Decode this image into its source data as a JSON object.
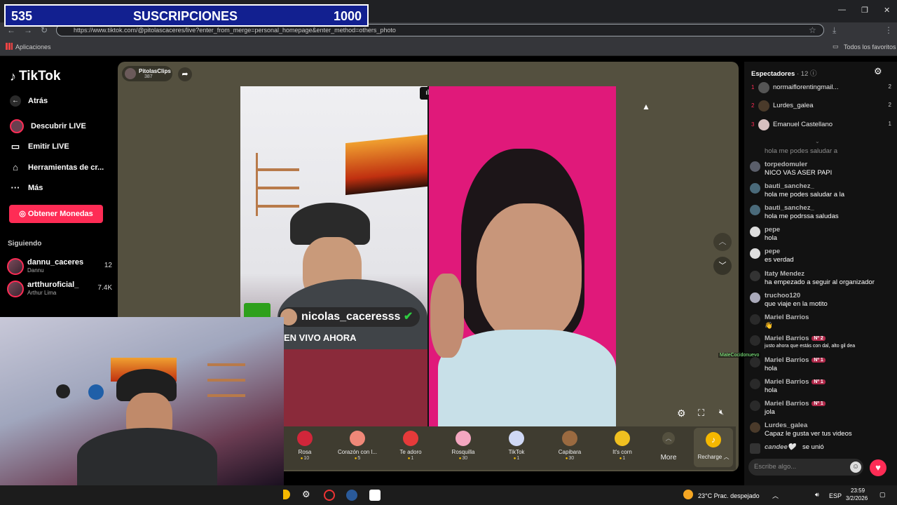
{
  "overlay": {
    "sub_current": "535",
    "sub_label": "SUSCRIPCIONES",
    "sub_goal": "1000"
  },
  "browser": {
    "url": "https://www.tiktok.com/@pitolascaceres/live?enter_from_merge=personal_homepage&enter_method=others_photo",
    "bookmark_apps": "Aplicaciones",
    "bookmark_all": "Todos los favoritos",
    "new_tab_icon": "+"
  },
  "sidebar": {
    "logo": "TikTok",
    "back": "Atrás",
    "items": [
      {
        "label": "Descubrir LIVE",
        "icon": "live-avatar-icon"
      },
      {
        "label": "Emitir LIVE",
        "icon": "camera-icon"
      },
      {
        "label": "Herramientas de cr...",
        "icon": "house-icon"
      },
      {
        "label": "Más",
        "icon": "dots-icon"
      }
    ],
    "coins_button": "Obtener Monedas",
    "following_title": "Siguiendo",
    "following": [
      {
        "name": "dannu_caceres",
        "sub": "Dannu",
        "count": "12"
      },
      {
        "name": "artthuroficial_",
        "sub": "Arthur Lima",
        "count": "7.4K"
      }
    ]
  },
  "stream": {
    "host_name": "PitolasClips",
    "host_likes": "387",
    "left_streamer_tag": "nicolas_caceresss",
    "live_now": "EN VIVO AHORA"
  },
  "gifts": [
    {
      "name": "Rosa",
      "cost": "10",
      "color": "#d1263a"
    },
    {
      "name": "Corazón con l...",
      "cost": "5",
      "color": "#f08878"
    },
    {
      "name": "Te adoro",
      "cost": "1",
      "color": "#e63a3a"
    },
    {
      "name": "Rosquilla",
      "cost": "30",
      "color": "#f4a6c0"
    },
    {
      "name": "TikTok",
      "cost": "1",
      "color": "#cfd8f5"
    },
    {
      "name": "Capibara",
      "cost": "30",
      "color": "#9a6a40"
    },
    {
      "name": "It's corn",
      "cost": "1",
      "color": "#f0c020"
    }
  ],
  "gift_more": "More",
  "recharge": "Recharge",
  "viewers": {
    "title": "Espectadores",
    "count": "· 12",
    "list": [
      {
        "rank": "1",
        "name": "normaiflorentingmail...",
        "count": "2"
      },
      {
        "rank": "2",
        "name": "Lurdes_galea",
        "count": "2"
      },
      {
        "rank": "3",
        "name": "Emanuel Castellano",
        "count": "1"
      }
    ]
  },
  "chat": [
    {
      "user": "",
      "text": "hola me podes saludar a",
      "badge": ""
    },
    {
      "user": "torpedomuler",
      "text": "NICO VAS ASER PAPI",
      "badge": ""
    },
    {
      "user": "bauti_sanchez_",
      "text": "hola me podes saludar a la",
      "badge": ""
    },
    {
      "user": "bauti_sanchez_",
      "text": "hola me podrssa saludas",
      "badge": ""
    },
    {
      "user": "pepe",
      "text": "hola",
      "badge": ""
    },
    {
      "user": "pepe",
      "text": "es verdad",
      "badge": ""
    },
    {
      "user": "Itaty Mendez",
      "text": "ha empezado a seguir al organizador",
      "badge": ""
    },
    {
      "user": "truchoo120",
      "text": "que viaje en la motito",
      "badge": ""
    },
    {
      "user": "Mariel Barrios",
      "text": "👋",
      "badge": ""
    },
    {
      "user": "Mariel Barrios",
      "text": "justo ahora que estás con dal, alto gil dea",
      "badge": "Nº 2"
    },
    {
      "user": "Mariel Barrios",
      "text": "hola",
      "badge": "Nº 1"
    },
    {
      "user": "Mariel Barrios",
      "text": "hola",
      "badge": "Nº 1"
    },
    {
      "user": "Mariel Barrios",
      "text": "jola",
      "badge": "Nº 1"
    },
    {
      "user": "Lurdes_galea",
      "text": "Capaz le gusta ver tus videos",
      "badge": ""
    }
  ],
  "join_notice": {
    "user": "candee🤍",
    "text": "se unió"
  },
  "floating_tag": "MateCocidonuevo",
  "chat_placeholder": "Escribe algo...",
  "taskbar": {
    "weather": "23°C  Prac. despejado",
    "lang": "ESP",
    "time": "23:59",
    "date": "3/2/2026"
  }
}
